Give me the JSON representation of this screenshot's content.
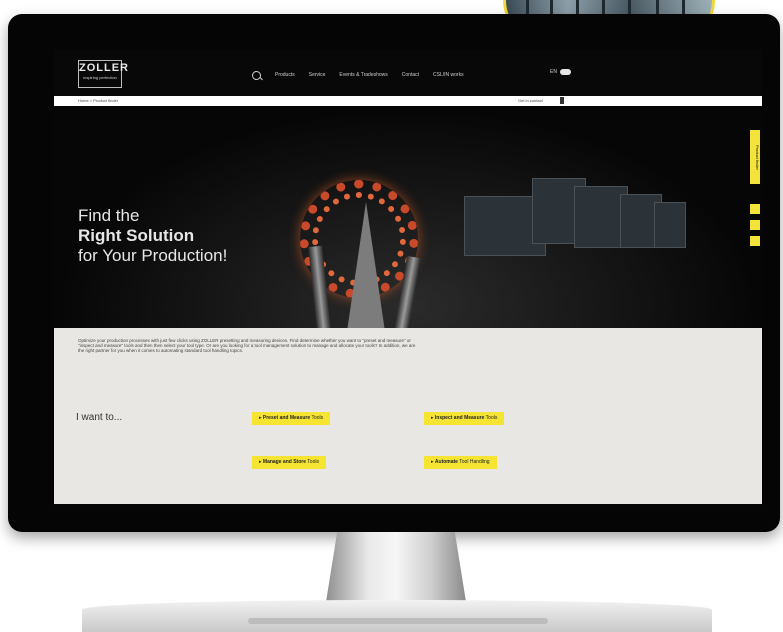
{
  "header": {
    "logo_text": "ZOLLER",
    "logo_subtext": "inspiring perfection",
    "nav_items": [
      "Products",
      "Service",
      "Events & Tradeshows",
      "Contact",
      "CSL/IN works"
    ],
    "language_label": "EN"
  },
  "breadcrumb": {
    "path": "Home > Product finder",
    "contact_label": "Get in contact"
  },
  "hero": {
    "headline_line1": "Find the",
    "headline_line2": "Right Solution",
    "headline_line3": "for Your Production!",
    "side_tab_label": "Product finder"
  },
  "content": {
    "intro_text": "Optimize your production processes with just few clicks using ZOLLER presetting and measuring devices. Find determine whether you want to \"preset and measure\" or \"inspect and measure\" tools and then then select your tool type. Or are you looking for a tool management solution to manage and allocate your tools? In addition, we are the right partner for you when it comes to automating standard tool handling topics.",
    "i_want_label": "I want to...",
    "buttons": [
      {
        "bold": "Preset and Measure",
        "rest": " Tools"
      },
      {
        "bold": "Inspect and Measure",
        "rest": " Tools"
      },
      {
        "bold": "Manage and Store",
        "rest": " Tools"
      },
      {
        "bold": "Automate",
        "rest": " Tool Handling"
      }
    ]
  },
  "colors": {
    "accent_yellow": "#f5e532",
    "background_dark": "#060606",
    "content_bg": "#e9e7e3"
  },
  "icons": [
    "search-icon",
    "language-toggle-icon",
    "contact-icon",
    "phone-icon",
    "folder-icon",
    "arrow-right-icon"
  ]
}
